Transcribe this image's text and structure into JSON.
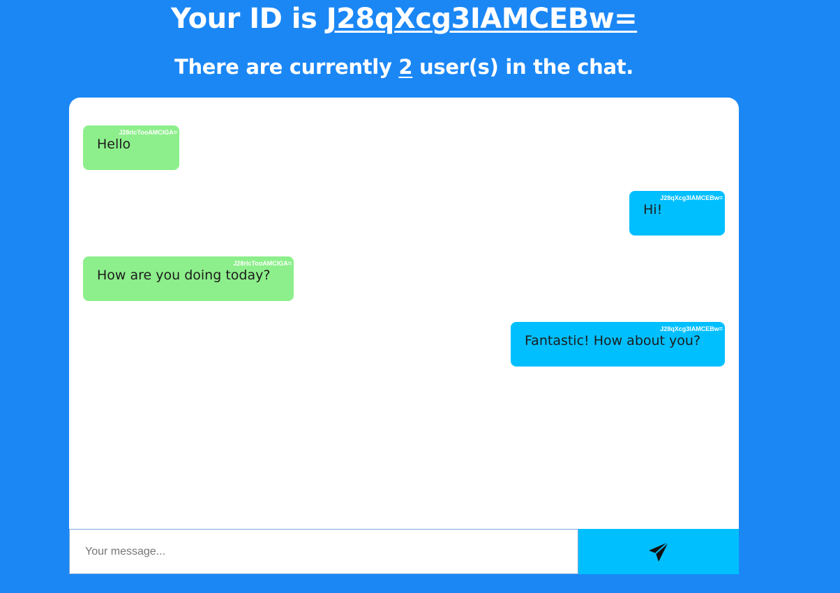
{
  "header": {
    "id_prefix": "Your ID is ",
    "user_id": "J28qXcg3IAMCEBw=",
    "count_prefix": "There are currently ",
    "user_count": "2",
    "count_suffix": " user(s) in the chat."
  },
  "messages": [
    {
      "sender": "J28rIcTooAMCIGA=",
      "text": "Hello",
      "direction": "received"
    },
    {
      "sender": "J28qXcg3IAMCEBw=",
      "text": "Hi!",
      "direction": "sent"
    },
    {
      "sender": "J28rIcTooAMCIGA=",
      "text": "How are you doing today?",
      "direction": "received"
    },
    {
      "sender": "J28qXcg3IAMCEBw=",
      "text": "Fantastic! How about you?",
      "direction": "sent"
    }
  ],
  "composer": {
    "placeholder": "Your message...",
    "value": "",
    "send_icon": "paper-plane-icon"
  },
  "colors": {
    "page_background": "#1b87f5",
    "received_bubble": "#8def8b",
    "sent_bubble": "#00bfff",
    "send_button": "#00bfff"
  }
}
